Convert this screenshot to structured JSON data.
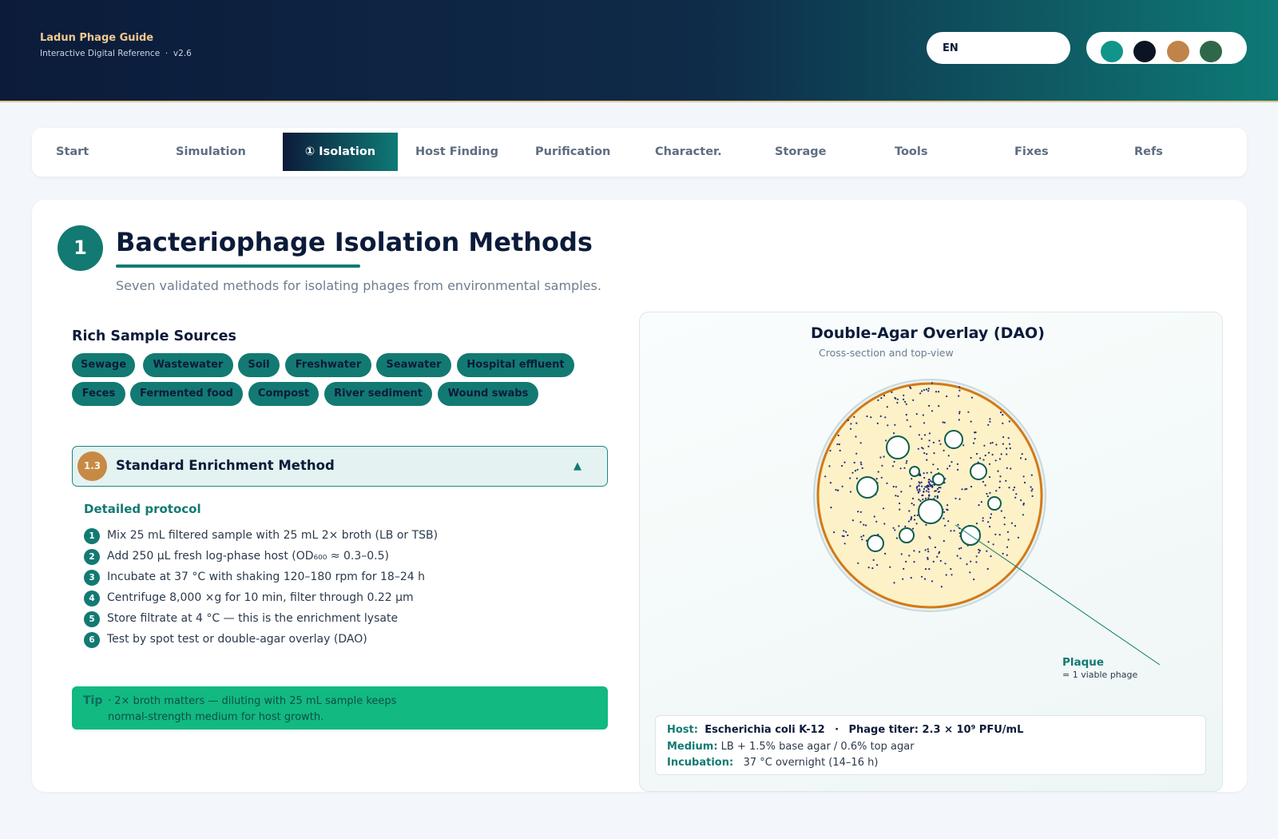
{
  "app": {
    "title": "Ladun Phage Guide",
    "subtitle": "Interactive Digital Reference",
    "separator": "·",
    "version": "v2.6",
    "language": "EN",
    "theme_swatches": [
      {
        "name": "teal",
        "color": "#11958a"
      },
      {
        "name": "navy",
        "color": "#0c1424"
      },
      {
        "name": "copper",
        "color": "#c0844b"
      },
      {
        "name": "green",
        "color": "#2f6848"
      }
    ]
  },
  "nav": {
    "tabs": [
      {
        "id": "start",
        "label": "Start",
        "active": false
      },
      {
        "id": "simulation",
        "label": "Simulation",
        "active": false
      },
      {
        "id": "isolation",
        "label": "① Isolation",
        "active": true
      },
      {
        "id": "host-finding",
        "label": "Host Finding",
        "active": false
      },
      {
        "id": "purification",
        "label": "Purification",
        "active": false
      },
      {
        "id": "character",
        "label": "Character.",
        "active": false
      },
      {
        "id": "storage",
        "label": "Storage",
        "active": false
      },
      {
        "id": "tools",
        "label": "Tools",
        "active": false
      },
      {
        "id": "fixes",
        "label": "Fixes",
        "active": false
      },
      {
        "id": "refs",
        "label": "Refs",
        "active": false
      }
    ]
  },
  "section": {
    "number": "1",
    "title": "Bacteriophage Isolation Methods",
    "subtitle": "Seven validated methods for isolating phages from environmental samples."
  },
  "sources": {
    "title": "Rich Sample Sources",
    "chips": [
      "Sewage",
      "Wastewater",
      "Soil",
      "Freshwater",
      "Seawater",
      "Hospital effluent",
      "Feces",
      "Fermented food",
      "Compost",
      "River sediment",
      "Wound swabs"
    ]
  },
  "method": {
    "number": "1.3",
    "title": "Standard Enrichment Method",
    "expanded": true,
    "caret": "▲",
    "protocol_title": "Detailed protocol",
    "steps": [
      {
        "n": "1",
        "text": "Mix 25 mL filtered sample with 25 mL 2× broth (LB or TSB)"
      },
      {
        "n": "2",
        "text": "Add 250 µL fresh log-phase host (OD₆₀₀ ≈ 0.3–0.5)"
      },
      {
        "n": "3",
        "text": "Incubate at 37 °C with shaking 120–180 rpm for 18–24 h"
      },
      {
        "n": "4",
        "text": "Centrifuge 8,000 ×g for 10 min, filter through 0.22 µm"
      },
      {
        "n": "5",
        "text": "Store filtrate at 4 °C — this is the enrichment lysate"
      },
      {
        "n": "6",
        "text": "Test by spot test or double-agar overlay (DAO)"
      }
    ]
  },
  "tip": {
    "label": "Tip",
    "line1": "· 2× broth matters — diluting with 25 mL sample keeps",
    "line2": "normal-strength medium for host growth."
  },
  "figure": {
    "title": "Double-Agar Overlay (DAO)",
    "subtitle": "Cross-section and top-view",
    "plaque_label": "Plaque",
    "plaque_sub": "= 1 viable phage",
    "colors": {
      "agar": "#fdf1c8",
      "rim": "#d27a17",
      "plaque_ring": "#0f5d4c",
      "colony": "#1d2a86"
    },
    "info": {
      "host_label": "Host:",
      "host_value": "Escherichia coli K-12",
      "dot": "·",
      "titer": "Phage titer: 2.3 × 10⁹ PFU/mL",
      "medium_label": "Medium:",
      "medium_value": "LB + 1.5% base agar / 0.6% top agar",
      "incubation_label": "Incubation:",
      "incubation_value": "37 °C overnight (14–16 h)"
    }
  }
}
